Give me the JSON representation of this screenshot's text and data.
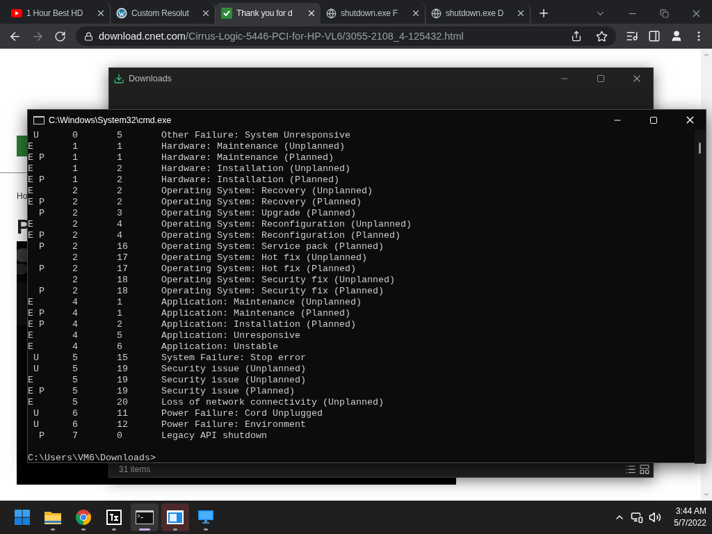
{
  "browser": {
    "tabs": [
      {
        "title": "1 Hour Best HD",
        "kind": "youtube",
        "selected": false
      },
      {
        "title": "Custom Resolut",
        "kind": "wordpress",
        "selected": false
      },
      {
        "title": "Thank you for d",
        "kind": "check",
        "selected": true
      },
      {
        "title": "shutdown.exe F",
        "kind": "globe",
        "selected": false
      },
      {
        "title": "shutdown.exe D",
        "kind": "globe",
        "selected": false
      }
    ],
    "back": {
      "disabled": false
    },
    "forward": {
      "disabled": true
    },
    "url": {
      "host": "download.cnet.com",
      "path": "/Cirrus-Logic-5446-PCI-for-HP-VL6/3055-2108_4-125432.html"
    }
  },
  "webpage": {
    "breadcrumb": "Ho",
    "heading": "P"
  },
  "downloads_window": {
    "title": "Downloads",
    "status": "31 items"
  },
  "cmd_window": {
    "title": "C:\\Windows\\System32\\cmd.exe",
    "lines": [
      " U      0       5       Other Failure: System Unresponsive",
      "E       1       1       Hardware: Maintenance (Unplanned)",
      "E P     1       1       Hardware: Maintenance (Planned)",
      "E       1       2       Hardware: Installation (Unplanned)",
      "E P     1       2       Hardware: Installation (Planned)",
      "E       2       2       Operating System: Recovery (Unplanned)",
      "E P     2       2       Operating System: Recovery (Planned)",
      "  P     2       3       Operating System: Upgrade (Planned)",
      "E       2       4       Operating System: Reconfiguration (Unplanned)",
      "E P     2       4       Operating System: Reconfiguration (Planned)",
      "  P     2       16      Operating System: Service pack (Planned)",
      "        2       17      Operating System: Hot fix (Unplanned)",
      "  P     2       17      Operating System: Hot fix (Planned)",
      "        2       18      Operating System: Security fix (Unplanned)",
      "  P     2       18      Operating System: Security fix (Planned)",
      "E       4       1       Application: Maintenance (Unplanned)",
      "E P     4       1       Application: Maintenance (Planned)",
      "E P     4       2       Application: Installation (Planned)",
      "E       4       5       Application: Unresponsive",
      "E       4       6       Application: Unstable",
      " U      5       15      System Failure: Stop error",
      " U      5       19      Security issue (Unplanned)",
      "E       5       19      Security issue (Unplanned)",
      "E P     5       19      Security issue (Planned)",
      "E       5       20      Loss of network connectivity (Unplanned)",
      " U      6       11      Power Failure: Cord Unplugged",
      " U      6       12      Power Failure: Environment",
      "  P     7       0       Legacy API shutdown"
    ],
    "prompt": "C:\\Users\\VM6\\Downloads>"
  },
  "taskbar": {
    "apps": [
      {
        "kind": "start",
        "running": false,
        "selected": false,
        "attention": false
      },
      {
        "kind": "explorer",
        "running": true,
        "selected": false,
        "attention": false
      },
      {
        "kind": "chrome",
        "running": true,
        "selected": false,
        "attention": false
      },
      {
        "kind": "archiver",
        "running": true,
        "selected": false,
        "attention": false
      },
      {
        "kind": "terminal",
        "running": true,
        "selected": true,
        "attention": false
      },
      {
        "kind": "app",
        "running": true,
        "selected": false,
        "attention": true
      },
      {
        "kind": "monitor",
        "running": true,
        "selected": false,
        "attention": false
      }
    ],
    "time": "3:44 AM",
    "date": "5/7/2022"
  }
}
